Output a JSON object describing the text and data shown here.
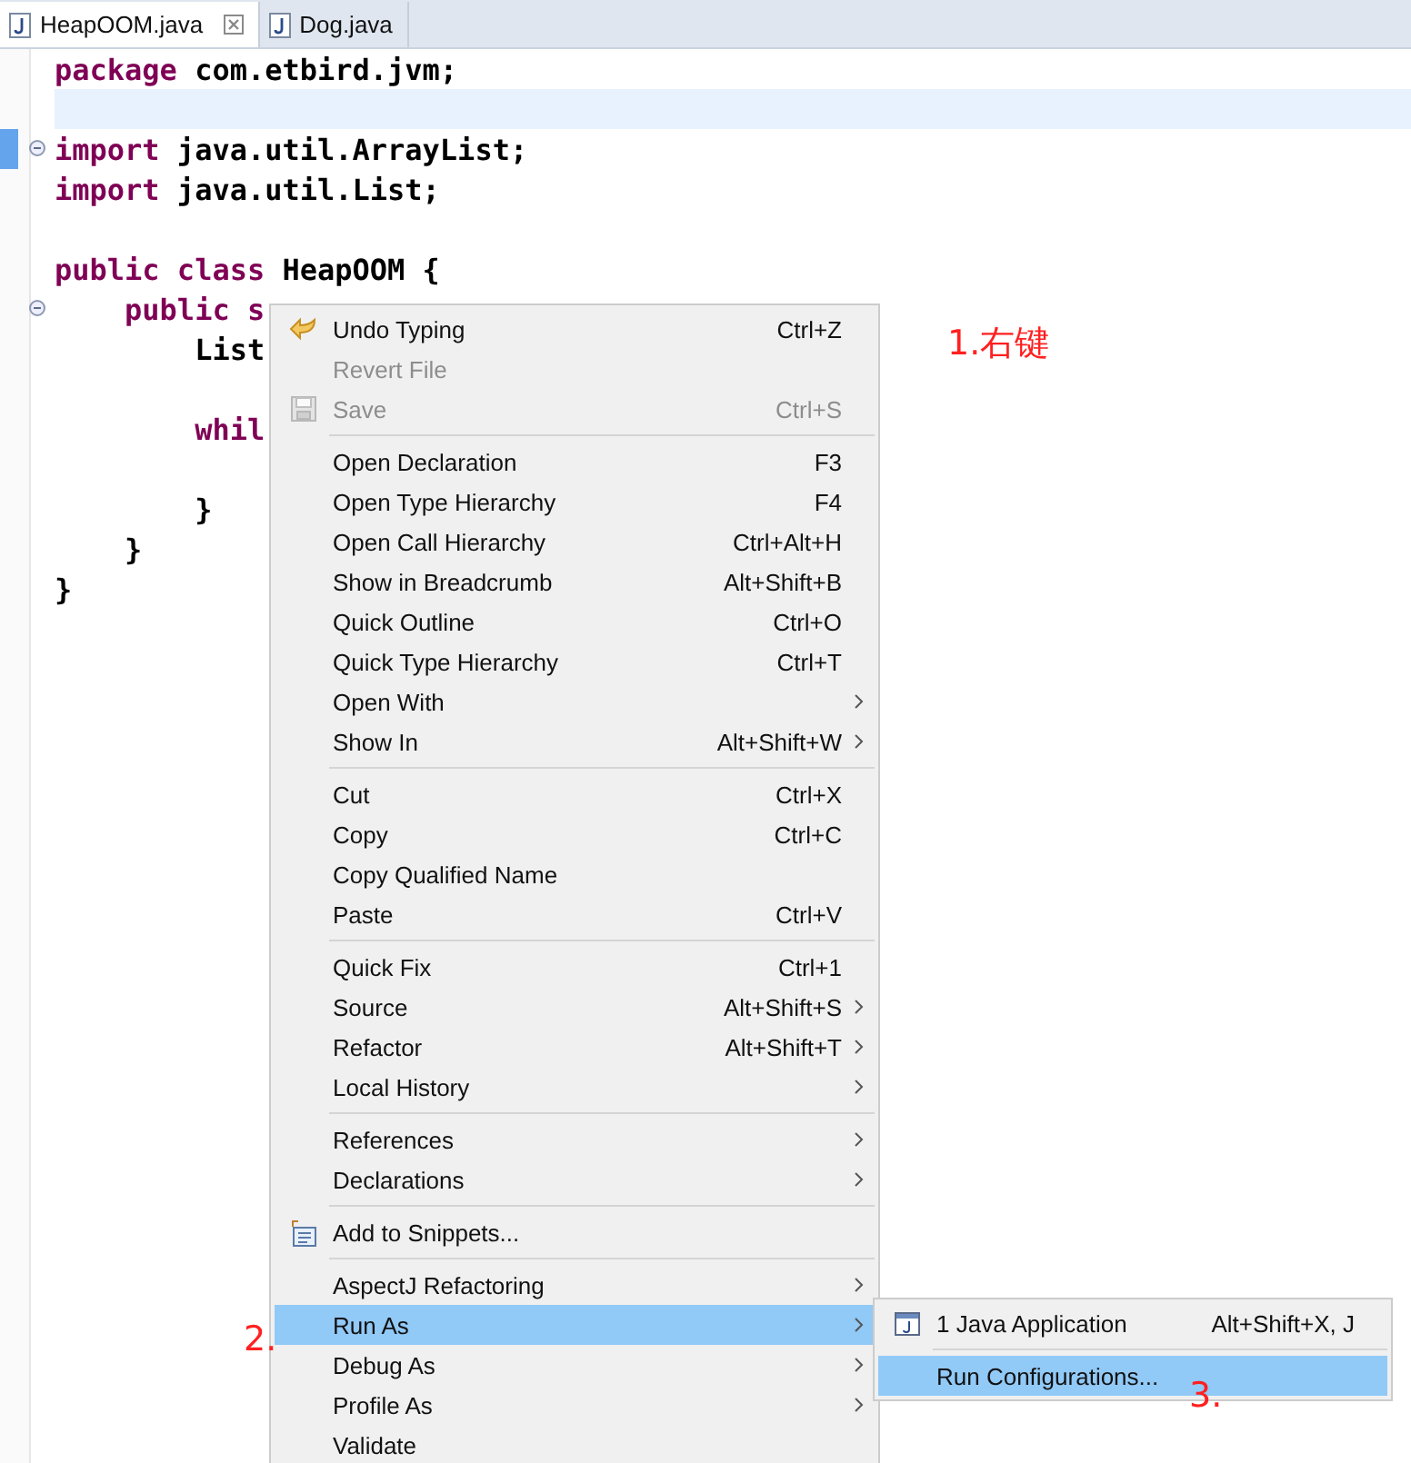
{
  "tabs": [
    {
      "label": "HeapOOM.java",
      "selected": true
    },
    {
      "label": "Dog.java",
      "selected": false
    }
  ],
  "code_lines": [
    {
      "fold": false,
      "current": false,
      "changed": false,
      "segments": [
        {
          "kind": "keyword",
          "text": "package"
        },
        {
          "kind": "plain",
          "text": " com.etbird.jvm;"
        }
      ]
    },
    {
      "fold": false,
      "current": true,
      "changed": false
    },
    {
      "fold": true,
      "current": false,
      "changed": true,
      "segments": [
        {
          "kind": "keyword",
          "text": "import"
        },
        {
          "kind": "plain",
          "text": " java.util.ArrayList;"
        }
      ]
    },
    {
      "fold": false,
      "current": false,
      "changed": false,
      "segments": [
        {
          "kind": "keyword",
          "text": "import"
        },
        {
          "kind": "plain",
          "text": " java.util.List;"
        }
      ]
    },
    {
      "fold": false,
      "current": false,
      "changed": false
    },
    {
      "fold": false,
      "current": false,
      "changed": false,
      "segments": [
        {
          "kind": "keyword",
          "text": "public class"
        },
        {
          "kind": "plain",
          "text": " HeapOOM {"
        }
      ]
    },
    {
      "fold": true,
      "current": false,
      "changed": false,
      "segments": [
        {
          "kind": "keyword",
          "text": "    public s"
        }
      ]
    },
    {
      "fold": false,
      "current": false,
      "changed": false,
      "segments": [
        {
          "kind": "plain",
          "text": "        List"
        }
      ]
    },
    {
      "fold": false,
      "current": false,
      "changed": false
    },
    {
      "fold": false,
      "current": false,
      "changed": false,
      "segments": [
        {
          "kind": "keyword",
          "text": "        whil"
        }
      ]
    },
    {
      "fold": false,
      "current": false,
      "changed": false
    },
    {
      "fold": false,
      "current": false,
      "changed": false,
      "segments": [
        {
          "kind": "plain",
          "text": "        }"
        }
      ]
    },
    {
      "fold": false,
      "current": false,
      "changed": false,
      "segments": [
        {
          "kind": "plain",
          "text": "    }"
        }
      ]
    },
    {
      "fold": false,
      "current": false,
      "changed": false,
      "segments": [
        {
          "kind": "plain",
          "text": "}"
        }
      ]
    }
  ],
  "context_menu": {
    "groups": [
      [
        {
          "label": "Undo Typing",
          "shortcut": "Ctrl+Z",
          "submenu": false,
          "disabled": false,
          "selected": false
        },
        {
          "label": "Revert File",
          "submenu": false,
          "disabled": true,
          "selected": false
        },
        {
          "label": "Save",
          "shortcut": "Ctrl+S",
          "submenu": false,
          "disabled": true,
          "selected": false
        }
      ],
      [
        {
          "label": "Open Declaration",
          "shortcut": "F3",
          "submenu": false,
          "disabled": false,
          "selected": false
        },
        {
          "label": "Open Type Hierarchy",
          "shortcut": "F4",
          "submenu": false,
          "disabled": false,
          "selected": false
        },
        {
          "label": "Open Call Hierarchy",
          "shortcut": "Ctrl+Alt+H",
          "submenu": false,
          "disabled": false,
          "selected": false
        },
        {
          "label": "Show in Breadcrumb",
          "shortcut": "Alt+Shift+B",
          "submenu": false,
          "disabled": false,
          "selected": false
        },
        {
          "label": "Quick Outline",
          "shortcut": "Ctrl+O",
          "submenu": false,
          "disabled": false,
          "selected": false
        },
        {
          "label": "Quick Type Hierarchy",
          "shortcut": "Ctrl+T",
          "submenu": false,
          "disabled": false,
          "selected": false
        },
        {
          "label": "Open With",
          "submenu": true,
          "disabled": false,
          "selected": false
        },
        {
          "label": "Show In",
          "shortcut": "Alt+Shift+W",
          "submenu": true,
          "disabled": false,
          "selected": false
        }
      ],
      [
        {
          "label": "Cut",
          "shortcut": "Ctrl+X",
          "submenu": false,
          "disabled": false,
          "selected": false
        },
        {
          "label": "Copy",
          "shortcut": "Ctrl+C",
          "submenu": false,
          "disabled": false,
          "selected": false
        },
        {
          "label": "Copy Qualified Name",
          "submenu": false,
          "disabled": false,
          "selected": false
        },
        {
          "label": "Paste",
          "shortcut": "Ctrl+V",
          "submenu": false,
          "disabled": false,
          "selected": false
        }
      ],
      [
        {
          "label": "Quick Fix",
          "shortcut": "Ctrl+1",
          "submenu": false,
          "disabled": false,
          "selected": false
        },
        {
          "label": "Source",
          "shortcut": "Alt+Shift+S",
          "submenu": true,
          "disabled": false,
          "selected": false
        },
        {
          "label": "Refactor",
          "shortcut": "Alt+Shift+T",
          "submenu": true,
          "disabled": false,
          "selected": false
        },
        {
          "label": "Local History",
          "submenu": true,
          "disabled": false,
          "selected": false
        }
      ],
      [
        {
          "label": "References",
          "submenu": true,
          "disabled": false,
          "selected": false
        },
        {
          "label": "Declarations",
          "submenu": true,
          "disabled": false,
          "selected": false
        }
      ],
      [
        {
          "label": "Add to Snippets...",
          "submenu": false,
          "disabled": false,
          "selected": false
        }
      ],
      [
        {
          "label": "AspectJ Refactoring",
          "submenu": true,
          "disabled": false,
          "selected": false
        },
        {
          "label": "Run As",
          "submenu": true,
          "disabled": false,
          "selected": true
        },
        {
          "label": "Debug As",
          "submenu": true,
          "disabled": false,
          "selected": false
        },
        {
          "label": "Profile As",
          "submenu": true,
          "disabled": false,
          "selected": false
        },
        {
          "label": "Validate",
          "submenu": false,
          "disabled": false,
          "selected": false
        }
      ]
    ]
  },
  "submenu": {
    "groups": [
      [
        {
          "label": "1 Java Application",
          "shortcut": "Alt+Shift+X, J",
          "selected": false
        }
      ],
      [
        {
          "label": "Run Configurations...",
          "selected": true
        }
      ]
    ]
  },
  "annotations": [
    {
      "text": "1.右键"
    },
    {
      "text": "2."
    },
    {
      "text": "3."
    }
  ]
}
